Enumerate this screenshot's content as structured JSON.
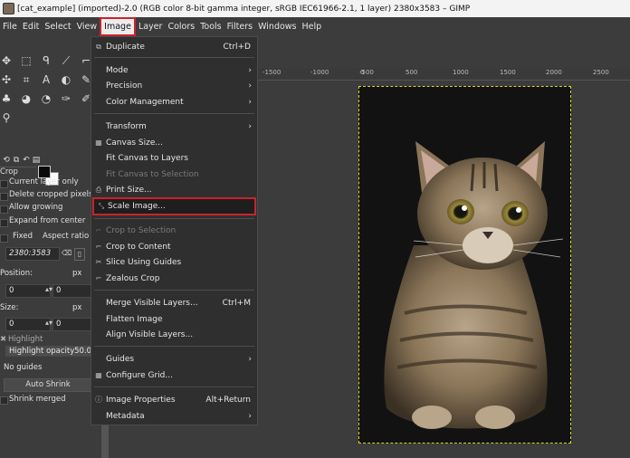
{
  "titlebar": {
    "title": "[cat_example] (imported)-2.0 (RGB color 8-bit gamma integer, sRGB IEC61966-2.1, 1 layer) 2380x3583 – GIMP"
  },
  "menubar": {
    "items": [
      "File",
      "Edit",
      "Select",
      "View",
      "Image",
      "Layer",
      "Colors",
      "Tools",
      "Filters",
      "Windows",
      "Help"
    ],
    "active": "Image"
  },
  "image_menu": {
    "items": [
      {
        "label": "Duplicate",
        "shortcut": "Ctrl+D",
        "icon": "duplicate-icon"
      },
      {
        "label": "Mode",
        "submenu": true
      },
      {
        "label": "Precision",
        "submenu": true
      },
      {
        "label": "Color Management",
        "submenu": true
      },
      {
        "label": "Transform",
        "submenu": true
      },
      {
        "label": "Canvas Size...",
        "icon": "canvas-size-icon"
      },
      {
        "label": "Fit Canvas to Layers"
      },
      {
        "label": "Fit Canvas to Selection",
        "disabled": true
      },
      {
        "label": "Print Size...",
        "icon": "print-size-icon"
      },
      {
        "label": "Scale Image...",
        "icon": "scale-image-icon",
        "highlighted": true
      },
      {
        "label": "Crop to Selection",
        "icon": "crop-selection-icon",
        "disabled": true
      },
      {
        "label": "Crop to Content",
        "icon": "crop-content-icon"
      },
      {
        "label": "Slice Using Guides",
        "icon": "slice-guides-icon"
      },
      {
        "label": "Zealous Crop",
        "icon": "zealous-crop-icon"
      },
      {
        "label": "Merge Visible Layers...",
        "shortcut": "Ctrl+M"
      },
      {
        "label": "Flatten Image"
      },
      {
        "label": "Align Visible Layers..."
      },
      {
        "label": "Guides",
        "submenu": true
      },
      {
        "label": "Configure Grid...",
        "icon": "grid-icon"
      },
      {
        "label": "Image Properties",
        "shortcut": "Alt+Return",
        "icon": "info-icon"
      },
      {
        "label": "Metadata",
        "submenu": true
      }
    ]
  },
  "ruler": {
    "labels": [
      "-1500",
      "-1000",
      "-500",
      "0",
      "500",
      "1000",
      "1500",
      "2000",
      "2500"
    ]
  },
  "tool_options": {
    "tool_name": "Crop",
    "current_layer_only": "Current layer only",
    "delete_cropped": "Delete cropped pixels",
    "allow_growing": "Allow growing",
    "expand_from_center": "Expand from center",
    "fixed": "Fixed",
    "aspect_ratio": "Aspect ratio",
    "ratio_value": "2380:3583",
    "position_label": "Position:",
    "position_unit": "px",
    "position_x": "0",
    "position_y": "0",
    "size_label": "Size:",
    "size_unit": "px",
    "size_w": "0",
    "size_h": "0",
    "highlight": "Highlight",
    "highlight_opacity_label": "Highlight opacity",
    "highlight_opacity_value": "50.0",
    "guides": "No guides",
    "auto_shrink": "Auto Shrink",
    "shrink_merged": "Shrink merged"
  },
  "colors": {
    "accent_red": "#c8242b",
    "selection_border": "#d8d82a",
    "menu_bg": "#2f2f2f",
    "ui_bg": "#3c3c3c"
  }
}
